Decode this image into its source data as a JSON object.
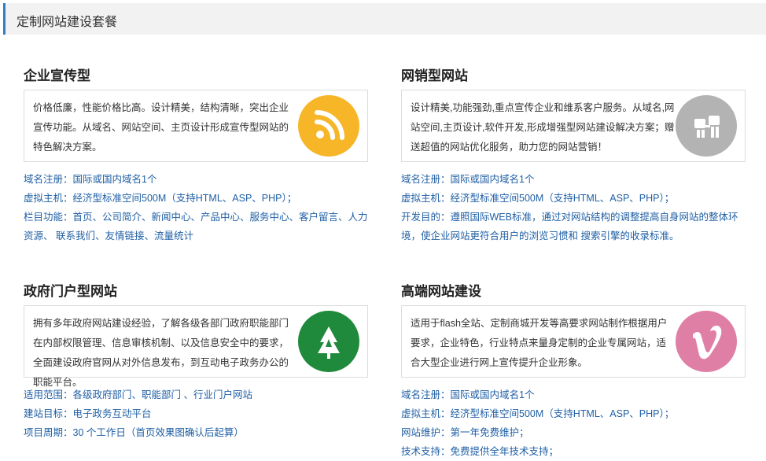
{
  "header": {
    "title": "定制网站建设套餐"
  },
  "colors": {
    "accent_bar": "#2f7fc1",
    "link_text": "#1f5fa5",
    "rss_icon_bg": "#f6b628",
    "user_icon_bg": "#b3b3b3",
    "tree_icon_bg": "#1f8a3b",
    "vimeo_icon_bg": "#e07fa5"
  },
  "cards": [
    {
      "title": "企业宣传型",
      "description": "价格低廉，性能价格比高。设计精美，结构清晰，突出企业宣传功能。从域名、网站空间、主页设计形成宣传型网站的特色解决方案。",
      "icon": "rss-icon",
      "details": [
        "域名注册：国际或国内域名1个",
        "虚拟主机：经济型标准空间500M（支持HTML、ASP、PHP）；",
        "栏目功能：首页、公司简介、新闻中心、产品中心、服务中心、客户留言、人力资源、 联系我们、友情链接、流量统计"
      ]
    },
    {
      "title": "网销型网站",
      "description": "设计精美,功能强劲,重点宣传企业和维系客户服务。从域名,网站空间,主页设计,软件开发,形成增强型网站建设解决方案；赠送超值的网站优化服务，助力您的网站营销！",
      "icon": "user-network-icon",
      "details": [
        "域名注册：国际或国内域名1个",
        "虚拟主机：经济型标准空间500M（支持HTML、ASP、PHP）；",
        "开发目的：遵照国际WEB标准，通过对网站结构的调整提高自身网站的整体环境，使企业网站更符合用户的浏览习惯和 搜索引擎的收录标准。"
      ]
    },
    {
      "title": "政府门户型网站",
      "description": "拥有多年政府网站建设经验，了解各级各部门政府职能部门在内部权限管理、信息审核机制、以及信息安全中的要求，全面建设政府官网从对外信息发布，到互动电子政务办公的职能平台。",
      "icon": "tree-icon",
      "details": [
        "适用范围：各级政府部门、职能部门 、行业门户网站",
        "建站目标：电子政务互动平台",
        "项目周期：30 个工作日（首页效果图确认后起算）"
      ]
    },
    {
      "title": "高端网站建设",
      "description": "适用于flash全站、定制商城开发等高要求网站制作根据用户要求，企业特色，行业特点来量身定制的企业专属网站，适合大型企业进行网上宣传提升企业形象。",
      "icon": "vimeo-icon",
      "details": [
        "域名注册：国际或国内域名1个",
        "虚拟主机：经济型标准空间500M（支持HTML、ASP、PHP）；",
        "网站维护：第一年免费维护；",
        "技术支持：免费提供全年技术支持；"
      ]
    }
  ]
}
